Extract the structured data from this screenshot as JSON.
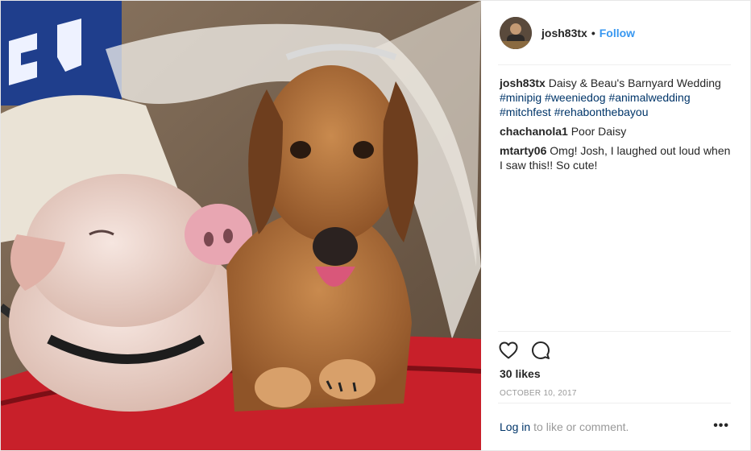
{
  "post": {
    "username": "josh83tx",
    "follow_label": "Follow",
    "separator": "•"
  },
  "caption": {
    "user": "josh83tx",
    "text": "Daisy & Beau's Barnyard Wedding",
    "hashtags": [
      "#minipig",
      "#weeniedog",
      "#animalwedding",
      "#mitchfest",
      "#rehabonthebayou"
    ]
  },
  "comments": [
    {
      "user": "chachanola1",
      "text": "Poor Daisy"
    },
    {
      "user": "mtarty06",
      "text": "Omg! Josh, I laughed out loud when I saw this!! So cute!"
    }
  ],
  "likes": "30 likes",
  "date": "OCTOBER 10, 2017",
  "footer": {
    "login_label": "Log in",
    "rest_text": "to like or comment.",
    "more_label": "•••"
  },
  "icons": {
    "like": "heart-outline-icon",
    "comment": "speech-bubble-icon",
    "more": "ellipsis-icon"
  },
  "colors": {
    "link_blue": "#3897f0",
    "hashtag_blue": "#003569",
    "muted_gray": "#999999"
  }
}
